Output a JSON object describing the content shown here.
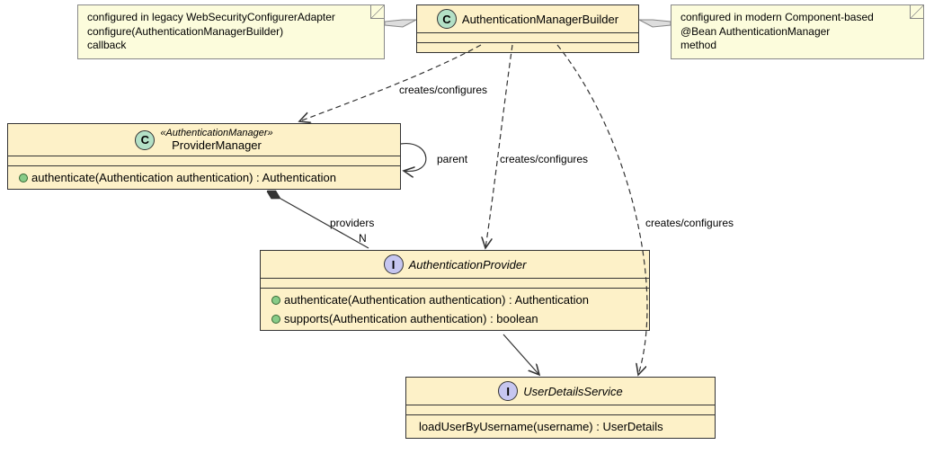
{
  "nodes": {
    "builder": {
      "name": "AuthenticationManagerBuilder",
      "badge": "C"
    },
    "providerManager": {
      "stereotype": "«AuthenticationManager»",
      "name": "ProviderManager",
      "badge": "C",
      "methods": [
        "authenticate(Authentication authentication) : Authentication"
      ]
    },
    "authProvider": {
      "name": "AuthenticationProvider",
      "badge": "I",
      "methods": [
        "authenticate(Authentication authentication) : Authentication",
        "supports(Authentication authentication) : boolean"
      ]
    },
    "userDetailsService": {
      "name": "UserDetailsService",
      "badge": "I",
      "methods": [
        "loadUserByUsername(username) : UserDetails"
      ]
    }
  },
  "notes": {
    "left": {
      "line1": "configured in legacy WebSecurityConfigurerAdapter",
      "line2": "  configure(AuthenticationManagerBuilder)",
      "line3": "callback"
    },
    "right": {
      "line1": "configured in modern Component-based",
      "line2": "  @Bean AuthenticationManager",
      "line3": "method"
    }
  },
  "edgeLabels": {
    "createsConfigures1": "creates/configures",
    "createsConfigures2": "creates/configures",
    "createsConfigures3": "creates/configures",
    "parent": "parent",
    "providers": "providers",
    "providersN": "N"
  }
}
